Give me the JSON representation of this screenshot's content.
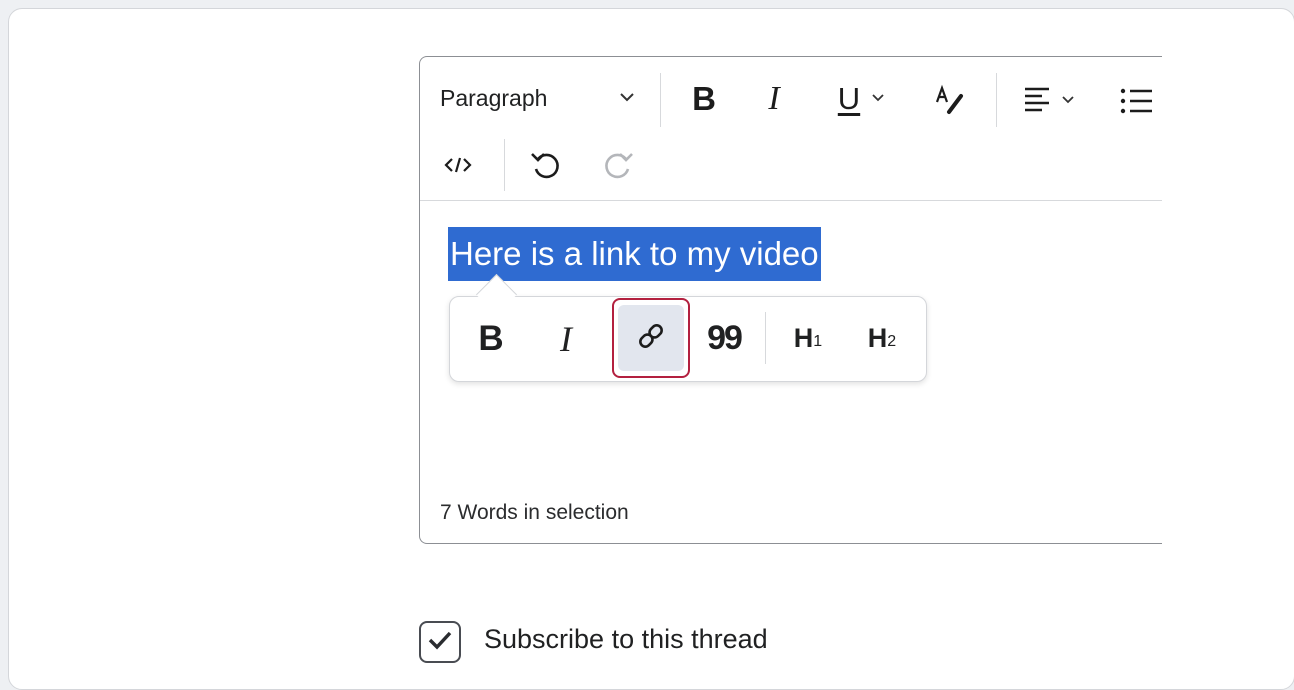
{
  "editor": {
    "toolbar": {
      "format_select": {
        "value": "Paragraph",
        "icon": "chevron-down-icon"
      },
      "buttons": {
        "bold": "B",
        "italic": "I",
        "underline": "U",
        "heading1": "H",
        "heading1_sub": "1",
        "heading2": "H",
        "heading2_sub": "2",
        "quote": "99"
      }
    },
    "content": {
      "selected_text": "Here is a link to my video"
    },
    "status": {
      "word_count": "7 Words in selection"
    }
  },
  "subscribe": {
    "label": "Subscribe to this thread",
    "checked": true
  },
  "colors": {
    "selection": "#2f6bd1",
    "active_highlight": "#b3203f",
    "active_bg": "#e2e6ee"
  }
}
